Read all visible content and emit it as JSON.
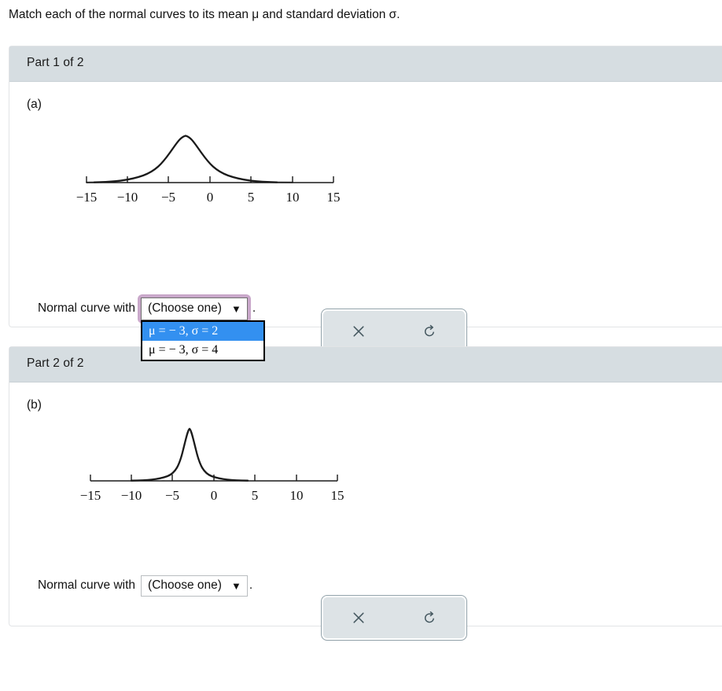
{
  "prompt": "Match each of the normal curves to its mean μ and standard deviation σ.",
  "parts": [
    {
      "header": "Part 1 of 2",
      "sub_label": "(a)",
      "answer_prefix": "Normal curve with",
      "period": ".",
      "select": {
        "value": "(Choose one)",
        "caret": "▼",
        "focused": true,
        "open": true,
        "options": [
          {
            "label": "μ = − 3,  σ = 2",
            "selected": true
          },
          {
            "label": "μ = − 3,  σ = 4",
            "selected": false
          }
        ]
      },
      "buttons": {
        "clear_icon": "x-icon",
        "reset_icon": "undo-arrow-icon"
      },
      "chart_data": {
        "type": "line",
        "title": "",
        "xlabel": "",
        "ylabel": "",
        "xlim": [
          -15,
          15
        ],
        "grid": false,
        "legend": null,
        "xticks": [
          -15,
          -10,
          -5,
          0,
          5,
          10,
          15
        ],
        "xticklabels": [
          "−15",
          "−10",
          "−5",
          "0",
          "5",
          "10",
          "15"
        ],
        "curve": {
          "mean": -3,
          "sd": 4,
          "distribution": "normal"
        }
      }
    },
    {
      "header": "Part 2 of 2",
      "sub_label": "(b)",
      "answer_prefix": "Normal curve with",
      "period": ".",
      "select": {
        "value": "(Choose one)",
        "caret": "▼",
        "focused": false,
        "open": false,
        "options": [
          {
            "label": "μ = − 3,  σ = 2",
            "selected": false
          },
          {
            "label": "μ = − 3,  σ = 4",
            "selected": false
          }
        ]
      },
      "buttons": {
        "clear_icon": "x-icon",
        "reset_icon": "undo-arrow-icon"
      },
      "chart_data": {
        "type": "line",
        "title": "",
        "xlabel": "",
        "ylabel": "",
        "xlim": [
          -15,
          15
        ],
        "grid": false,
        "legend": null,
        "xticks": [
          -15,
          -10,
          -5,
          0,
          5,
          10,
          15
        ],
        "xticklabels": [
          "−15",
          "−10",
          "−5",
          "0",
          "5",
          "10",
          "15"
        ],
        "curve": {
          "mean": -3,
          "sd": 2,
          "distribution": "normal"
        }
      }
    }
  ],
  "colors": {
    "panel_header_bg": "#d6dde1",
    "focus_ring": "#c9a8ca",
    "option_highlight": "#3390f0",
    "button_bg": "#dde3e6",
    "icon": "#44575f",
    "curve": "#1a1a1a"
  }
}
